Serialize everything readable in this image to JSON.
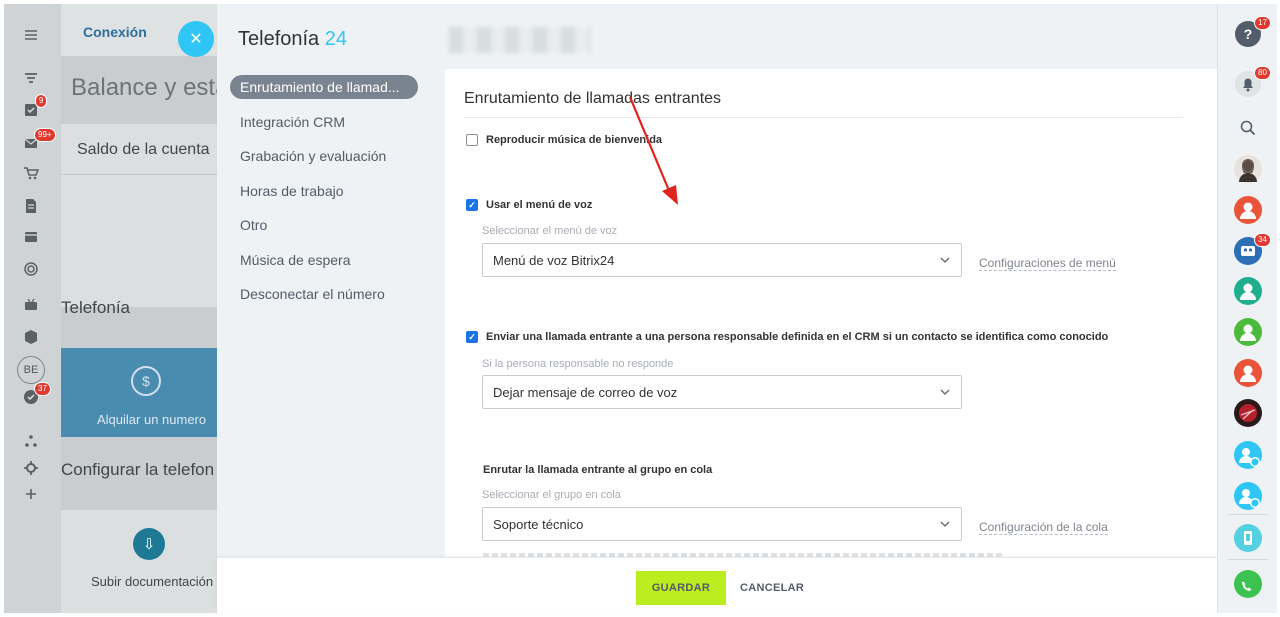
{
  "left_rail": {
    "badges": [
      "9",
      "99+",
      "37"
    ],
    "avatar_initials": "BE"
  },
  "background_page": {
    "tab_label": "Conexión",
    "title": "Balance y estad",
    "card_text": "Saldo de la cuenta",
    "section_telefonia": "Telefonía",
    "rent_tile_label": "Alquilar un numero",
    "section_config": "Configurar la telefon",
    "upload_tile_label": "Subir documentación"
  },
  "slider": {
    "title_main": "Telefonía",
    "title_accent": "24",
    "menu": [
      "Enrutamiento de llamad...",
      "Integración CRM",
      "Grabación y evaluación",
      "Horas de trabajo",
      "Otro",
      "Música de espera",
      "Desconectar el número"
    ],
    "content": {
      "section_title": "Enrutamiento de llamadas entrantes",
      "welcome_music_label": "Reproducir música de bienvenida",
      "voice_menu_label": "Usar el menú de voz",
      "voice_menu_sublabel": "Seleccionar el menú de voz",
      "voice_menu_value": "Menú de voz Bitrix24",
      "voice_menu_link": "Configuraciones de menú",
      "crm_label": "Enviar una llamada entrante a una persona responsable definida en el CRM si un contacto se identifica como conocido",
      "crm_sublabel": "Si la persona responsable no responde",
      "crm_value": "Dejar mensaje de correo de voz",
      "queue_title": "Enrutar la llamada entrante al grupo en cola",
      "queue_sublabel": "Seleccionar el grupo en cola",
      "queue_value": "Soporte técnico",
      "queue_link": "Configuración de la cola"
    },
    "footer": {
      "save_label": "GUARDAR",
      "cancel_label": "CANCELAR"
    }
  },
  "right_rail": {
    "help_badge": "17",
    "notifications_badge": "80",
    "group_chat_badge": "34"
  },
  "colors": {
    "accent": "#2fc6f6",
    "save_button": "#bbed21",
    "checkbox_checked": "#1a73e8",
    "annotation_arrow": "#e0231c"
  }
}
